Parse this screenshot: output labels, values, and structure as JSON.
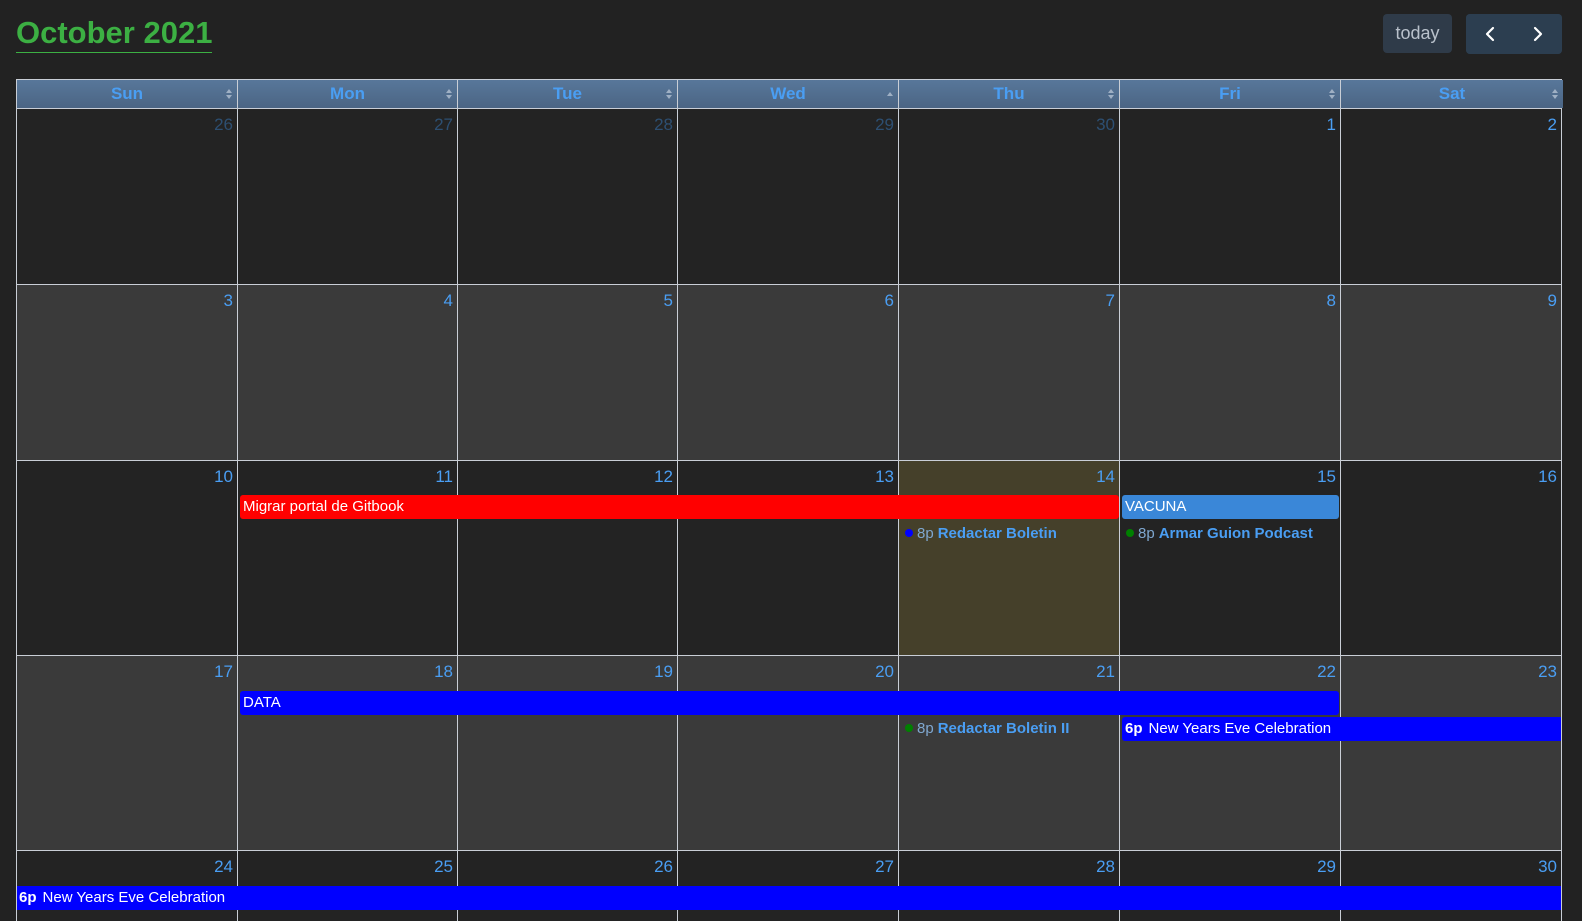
{
  "toolbar": {
    "title": "October 2021",
    "today_label": "today",
    "prev_icon": "chevron-left-icon",
    "next_icon": "chevron-right-icon"
  },
  "weekdays": [
    "Sun",
    "Mon",
    "Tue",
    "Wed",
    "Thu",
    "Fri",
    "Sat"
  ],
  "weeks": [
    [
      "26",
      "27",
      "28",
      "29",
      "30",
      "1",
      "2"
    ],
    [
      "3",
      "4",
      "5",
      "6",
      "7",
      "8",
      "9"
    ],
    [
      "10",
      "11",
      "12",
      "13",
      "14",
      "15",
      "16"
    ],
    [
      "17",
      "18",
      "19",
      "20",
      "21",
      "22",
      "23"
    ],
    [
      "24",
      "25",
      "26",
      "27",
      "28",
      "29",
      "30"
    ]
  ],
  "events": {
    "migrar": {
      "title": "Migrar portal de Gitbook",
      "color": "#ff0000"
    },
    "vacuna": {
      "title": "VACUNA",
      "color": "#3a87d8"
    },
    "boletin": {
      "time": "8p",
      "title": "Redactar Boletin",
      "dot_color": "#0000ff"
    },
    "podcast": {
      "time": "8p",
      "title": "Armar Guion Podcast",
      "dot_color": "#008000"
    },
    "data": {
      "title": "DATA",
      "color": "#0000ff"
    },
    "boletin2": {
      "time": "8p",
      "title": "Redactar Boletin II",
      "dot_color": "#008000"
    },
    "nye1": {
      "time": "6p",
      "title": "New Years Eve Celebration",
      "color": "#0000ff"
    },
    "nye2": {
      "time": "6p",
      "title": "New Years Eve Celebration",
      "color": "#0000ff"
    }
  },
  "colors": {
    "title_green": "#3cb043",
    "day_number_blue": "#4a9ef3",
    "header_bg": "#4e6a8a",
    "today_highlight": "#45402a"
  }
}
